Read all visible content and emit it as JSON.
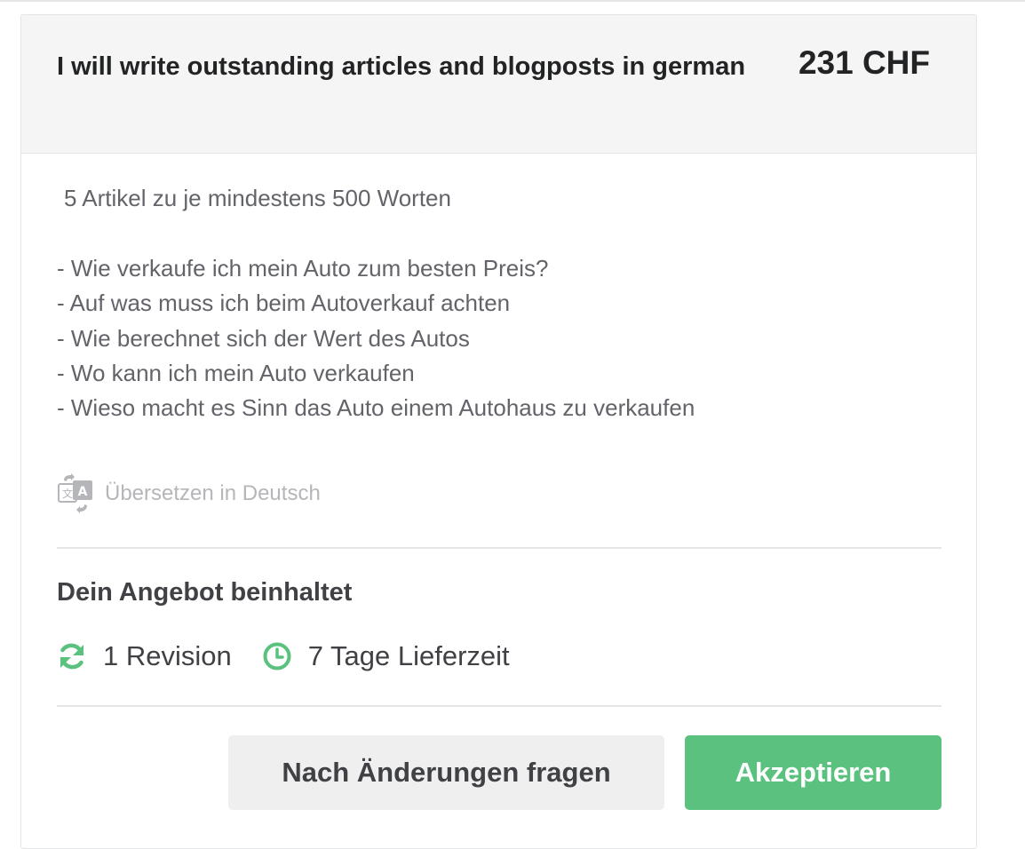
{
  "offer": {
    "title": "I will write outstanding articles and blogposts in german",
    "price": "231 CHF",
    "description_intro": "5 Artikel zu je mindestens 500 Worten",
    "description_lines": [
      "- Wie verkaufe ich mein Auto zum besten Preis?",
      "- Auf was muss ich beim Autoverkauf achten",
      "- Wie berechnet sich der Wert des Autos",
      "- Wo kann ich mein Auto verkaufen",
      "- Wieso macht es Sinn das Auto einem Autohaus zu verkaufen"
    ],
    "translate_label": "Übersetzen in Deutsch",
    "translate_icon": "translate-icon"
  },
  "includes": {
    "heading": "Dein Angebot beinhaltet",
    "items": [
      {
        "icon": "refresh-icon",
        "label": "1 Revision"
      },
      {
        "icon": "clock-icon",
        "label": "7 Tage Lieferzeit"
      }
    ]
  },
  "actions": {
    "request_changes_label": "Nach Änderungen fragen",
    "accept_label": "Akzeptieren"
  },
  "colors": {
    "accent_green": "#5bc17f",
    "icon_green": "#5bc17f",
    "header_bg": "#f5f5f5",
    "secondary_button_bg": "#efeff0",
    "muted_text": "#b5b6ba"
  }
}
